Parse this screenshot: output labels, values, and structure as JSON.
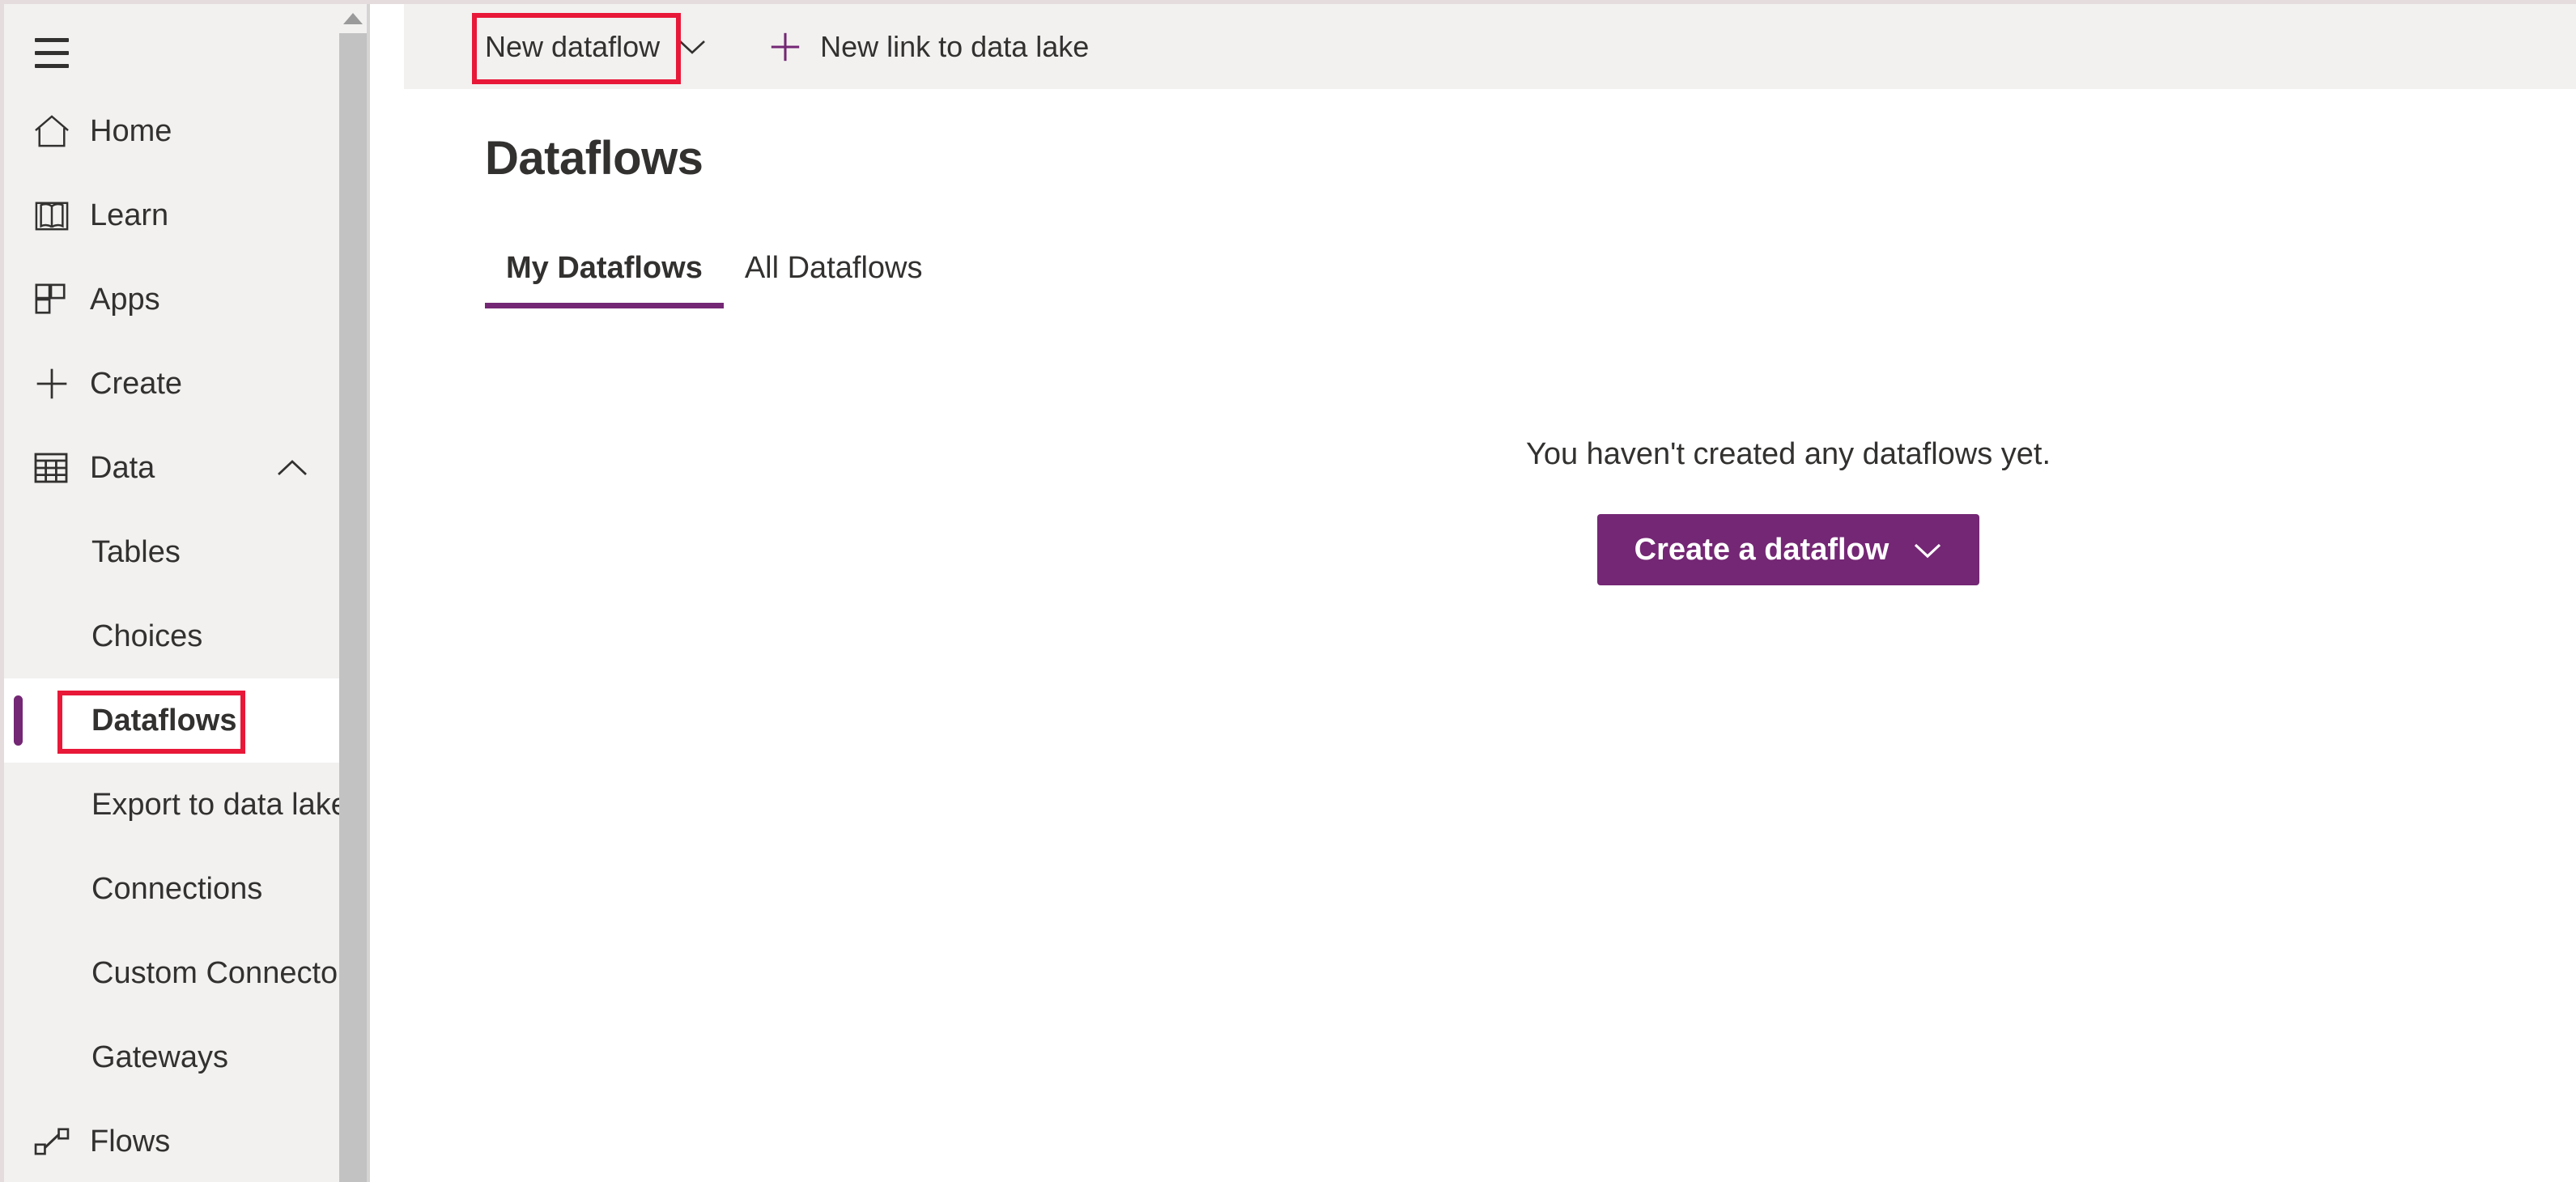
{
  "colors": {
    "accent": "#742774",
    "annotation": "#e81838",
    "sidebar_bg": "#f2f1f0",
    "toolbar_bg": "#f2f1f0",
    "content_bg": "#ffffff",
    "text": "#323130",
    "scrollbar_thumb": "#c2c2c2"
  },
  "sidebar": {
    "menu_button": "hamburger-menu",
    "items": [
      {
        "label": "Home",
        "icon": "home-icon",
        "level": "top",
        "selected": false,
        "expandable": false
      },
      {
        "label": "Learn",
        "icon": "book-icon",
        "level": "top",
        "selected": false,
        "expandable": false
      },
      {
        "label": "Apps",
        "icon": "apps-grid-icon",
        "level": "top",
        "selected": false,
        "expandable": false
      },
      {
        "label": "Create",
        "icon": "plus-icon",
        "level": "top",
        "selected": false,
        "expandable": false
      },
      {
        "label": "Data",
        "icon": "table-grid-icon",
        "level": "top",
        "selected": false,
        "expandable": true,
        "expanded": true,
        "chevron": "chevron-up-icon"
      },
      {
        "label": "Tables",
        "icon": "",
        "level": "sub",
        "selected": false,
        "expandable": false
      },
      {
        "label": "Choices",
        "icon": "",
        "level": "sub",
        "selected": false,
        "expandable": false
      },
      {
        "label": "Dataflows",
        "icon": "",
        "level": "sub",
        "selected": true,
        "expandable": false
      },
      {
        "label": "Export to data lake",
        "icon": "",
        "level": "sub",
        "selected": false,
        "expandable": false
      },
      {
        "label": "Connections",
        "icon": "",
        "level": "sub",
        "selected": false,
        "expandable": false
      },
      {
        "label": "Custom Connectors",
        "icon": "",
        "level": "sub",
        "selected": false,
        "expandable": false
      },
      {
        "label": "Gateways",
        "icon": "",
        "level": "sub",
        "selected": false,
        "expandable": false
      },
      {
        "label": "Flows",
        "icon": "flow-icon",
        "level": "top",
        "selected": false,
        "expandable": false
      }
    ],
    "scrollbar": {
      "up_arrow": "scroll-up-arrow-icon"
    }
  },
  "toolbar": {
    "new_dataflow_label": "New dataflow",
    "new_dataflow_chevron": "chevron-down-icon",
    "new_link_icon": "plus-icon",
    "new_link_label": "New link to data lake"
  },
  "main": {
    "page_title": "Dataflows",
    "tabs": [
      {
        "label": "My Dataflows",
        "active": true
      },
      {
        "label": "All Dataflows",
        "active": false
      }
    ],
    "empty_state": {
      "message": "You haven't created any dataflows yet.",
      "button_label": "Create a dataflow",
      "button_chevron": "chevron-down-icon"
    }
  },
  "annotations": [
    {
      "name": "new-dataflow-highlight",
      "target": "New dataflow"
    },
    {
      "name": "dataflows-nav-highlight",
      "target": "Dataflows"
    }
  ]
}
